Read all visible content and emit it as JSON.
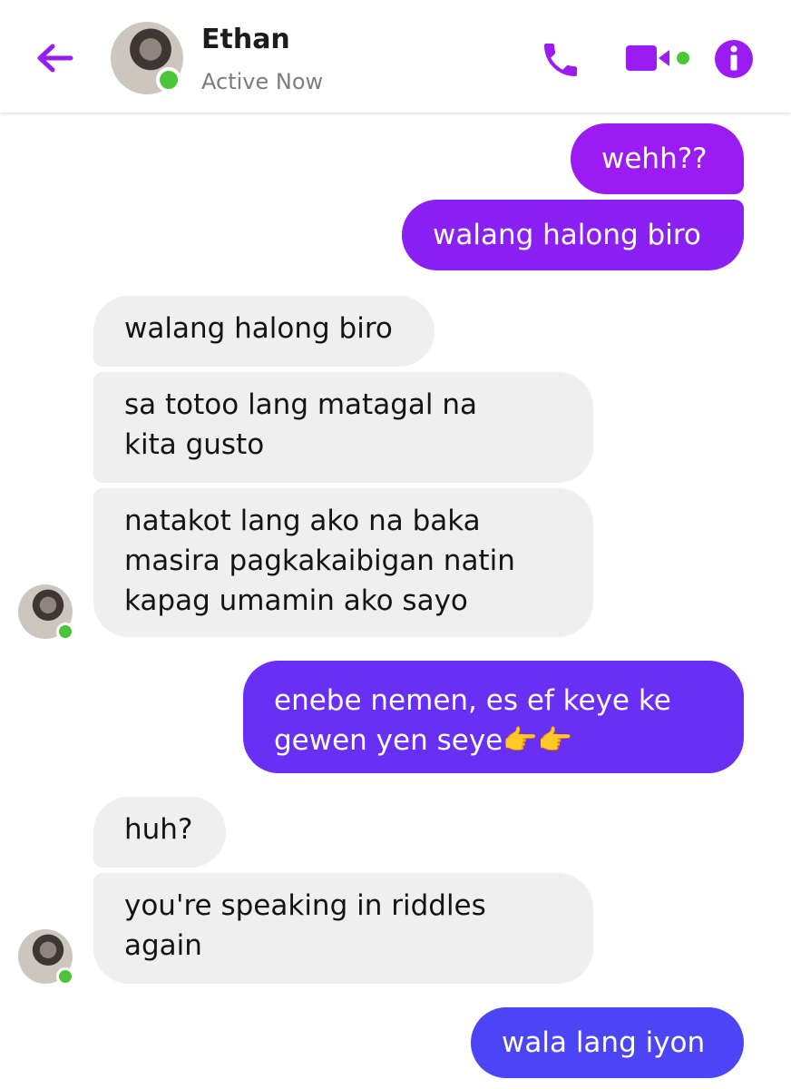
{
  "header": {
    "contact_name": "Ethan",
    "status": "Active Now",
    "icons": [
      "back-arrow-icon",
      "phone-icon",
      "video-camera-icon",
      "info-icon"
    ],
    "accent_color": "#9b1cf2",
    "online_color": "#4cc53a"
  },
  "messages": [
    {
      "from": "me",
      "text": "wehh??"
    },
    {
      "from": "me",
      "text": "walang halong biro"
    },
    {
      "from": "Ethan",
      "text": "walang halong biro"
    },
    {
      "from": "Ethan",
      "lines": [
        "sa totoo lang matagal na",
        "kita gusto"
      ]
    },
    {
      "from": "Ethan",
      "lines": [
        "natakot lang ako na baka",
        "masira pagkakaibigan natin",
        "kapag umamin ako sayo"
      ]
    },
    {
      "from": "me",
      "lines": [
        "enebe nemen, es ef keye ke",
        "gewen yen seye👉👉"
      ]
    },
    {
      "from": "Ethan",
      "text": "huh?"
    },
    {
      "from": "Ethan",
      "lines": [
        "you're speaking in riddles",
        "again"
      ]
    },
    {
      "from": "me",
      "text": "wala lang iyon"
    }
  ],
  "colors": {
    "sent_1": "#9b1cf2",
    "sent_2": "#8a20f3",
    "sent_3": "#6a2ff5",
    "sent_4": "#4b45f5",
    "received": "#efefef"
  }
}
